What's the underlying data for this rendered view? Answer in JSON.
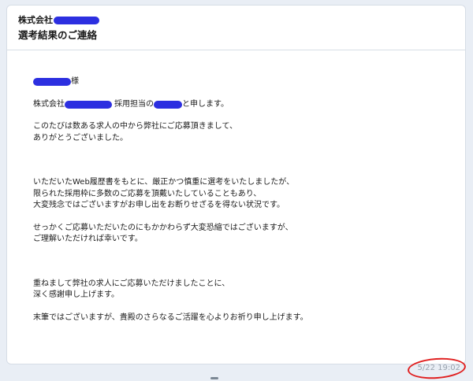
{
  "email": {
    "company_prefix": "株式会社",
    "subject": "選考結果のご連絡",
    "greeting_suffix": "様",
    "intro_prefix": "株式会社",
    "intro_mid": "採用担当の",
    "intro_suffix": "と申します。",
    "para1_line1": "このたびは数ある求人の中から弊社にご応募頂きまして、",
    "para1_line2": "ありがとうございました。",
    "para2_line1": "いただいたWeb履歴書をもとに、厳正かつ慎重に選考をいたしましたが、",
    "para2_line2": "限られた採用枠に多数のご応募を頂戴いたしていることもあり、",
    "para2_line3": "大変残念ではございますがお申し出をお断りせざるを得ない状況です。",
    "para3_line1": "せっかくご応募いただいたのにもかかわらず大変恐縮ではございますが、",
    "para3_line2": "ご理解いただければ幸いです。",
    "para4_line1": "重ねまして弊社の求人にご応募いただけましたことに、",
    "para4_line2": "深く感謝申し上げます。",
    "para5_line1": "末筆ではございますが、貴殿のさらなるご活躍を心よりお祈り申し上げます。",
    "timestamp": "5/22 19:02"
  },
  "colors": {
    "redaction": "#2c2fe0",
    "annotation_circle": "#e02020"
  }
}
